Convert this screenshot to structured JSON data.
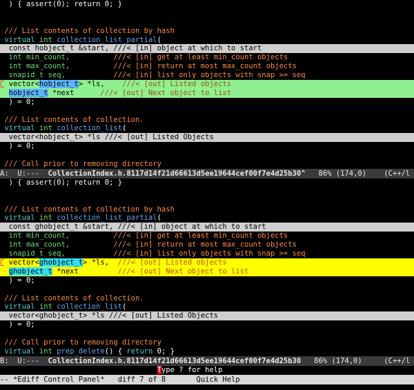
{
  "pane_a": {
    "lines": {
      "l1": ") { assert(0); return 0; }",
      "c1": "/// List contents of collection by hash",
      "d1a": "virtual int collection_list_partial(",
      "p1": "const hobject_t &start, ///< [in] object at which to start",
      "p2a": "int min_count,          ",
      "p2b": "///< [in] get at least min_count objects",
      "p3a": "int max_count,          ",
      "p3b": "///< [in] return at most max_count objects",
      "p4a": "snapid_t seq,           ",
      "p4b": "///< [in] list only objects with snap >= seq",
      "p5a": "vector<",
      "p5sel": "hobject_t",
      "p5b": "> *ls,    ",
      "p5c": "///< [out] Listed objects",
      "p6sel": "hobject_t",
      "p6b": " *next      ",
      "p6c": "///< [out] Next object to list",
      "p7": ") = 0;",
      "c2": "/// List contents of collection.",
      "d2": "virtual int collection_list(",
      "p8": "vector<hobject_t> *ls ///< [out] Listed Objects",
      "p9": ") = 0;",
      "c3": "/// Call prior to removing directory"
    },
    "modeline": {
      "prefix": "A:  U:---  ",
      "buffer": "CollectionIndex.h.8117d14f21d66613d5ee19644cef00f7e4d25b30^",
      "pos": "   86% (174,0)    ",
      "mode": "(C++/l Gt"
    }
  },
  "pane_b": {
    "lines": {
      "l1": ") { assert(0); return 0; }",
      "c1": "/// List contents of collection by hash",
      "d1": "virtual int collection_list_partial(",
      "p1": "const ghobject_t &start, ///< [in] object at which to start",
      "p2a": "int min_count,          ",
      "p2b": "///< [in] get at least min_count objects",
      "p3a": "int max_count,          ",
      "p3b": "///< [in] return at most max_count objects",
      "p4a": "snapid_t seq,           ",
      "p4b": "///< [in] list only objects with snap >= seq",
      "p5a": "vector<",
      "p5sel": "ghobject_t",
      "p5b": "> *ls,  ",
      "p5c": "///< [out] Listed objects",
      "p6sel": "ghobject_t",
      "p6b": " *next         ",
      "p6c": "///< [out] Next object to list",
      "p7": ") = 0;",
      "c2": "/// List contents of collection.",
      "d2": "virtual int collection_list(",
      "p8": "vector<ghobject_t> *ls ///< [out] Listed Objects",
      "p9": ") = 0;",
      "c3": "/// Call prior to removing directory",
      "d3": "virtual int prep_delete() { return 0; }"
    },
    "modeline": {
      "prefix": "B:  U:---  ",
      "buffer": "CollectionIndex.h.8117d14f21d66613d5ee19644cef00f7e4d25b30",
      "pos": "   86% (174,0)     ",
      "mode": "(C++/l Gta"
    }
  },
  "echo_area": {
    "cursor_char": "T",
    "text": "ype ? for help"
  },
  "control_panel": {
    "prefix": "-- ",
    "buffer": "*Ediff Control Panel*",
    "diff": "   diff 7 of 8       ",
    "help": "Quick Help"
  },
  "colors": {
    "comment": "#ff8c3c",
    "keyword": "#5ad2d2",
    "function": "#5fa8f0",
    "type": "#6edc6e",
    "diff_current_a": "#8ff08f",
    "diff_current_b": "#ffff00",
    "diff_other": "#cfcfcf"
  }
}
